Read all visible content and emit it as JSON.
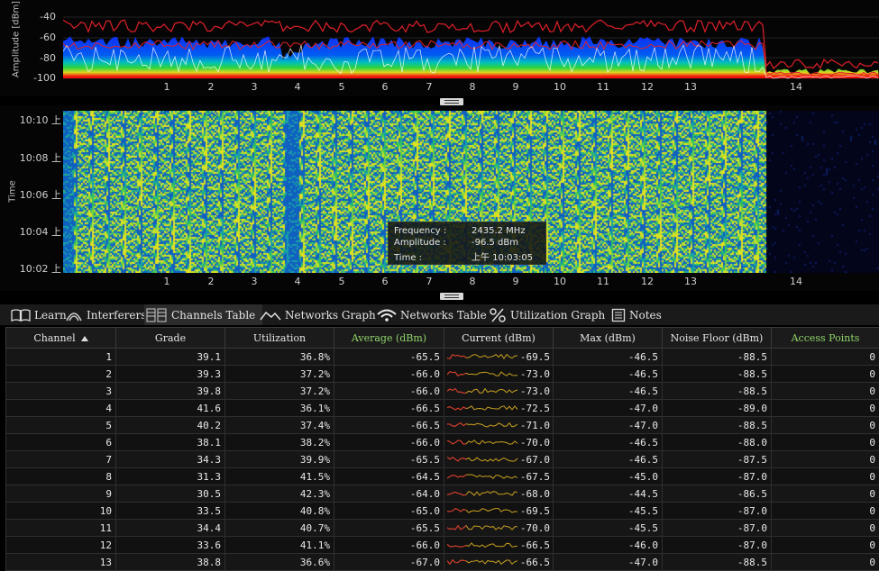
{
  "spectrum": {
    "ylabel": "Amplitude [dBm]",
    "yticks": [
      "-40",
      "-60",
      "-80",
      "-100"
    ],
    "xticks": [
      "1",
      "2",
      "3",
      "4",
      "5",
      "6",
      "7",
      "8",
      "9",
      "10",
      "11",
      "12",
      "13",
      "14"
    ]
  },
  "waterfall": {
    "ylabel": "Time",
    "yticks": [
      "10:10 上",
      "10:08 上",
      "10:06 上",
      "10:04 上",
      "10:02 上"
    ],
    "xticks": [
      "1",
      "2",
      "3",
      "4",
      "5",
      "6",
      "7",
      "8",
      "9",
      "10",
      "11",
      "12",
      "13",
      "14"
    ]
  },
  "tooltip": {
    "freq_label": "Frequency :",
    "freq_value": "2435.2 MHz",
    "amp_label": "Amplitude :",
    "amp_value": "-96.5 dBm",
    "time_label": "Time :",
    "time_value": "上午 10:03:05"
  },
  "tabs": [
    {
      "label": "Learn",
      "icon": "book-icon"
    },
    {
      "label": "Interferers",
      "icon": "interferer-icon"
    },
    {
      "label": "Channels Table",
      "icon": "table-icon",
      "active": true
    },
    {
      "label": "Networks Graph",
      "icon": "graph-icon"
    },
    {
      "label": "Networks Table",
      "icon": "wifi-icon"
    },
    {
      "label": "Utilization Graph",
      "icon": "percent-icon"
    },
    {
      "label": "Notes",
      "icon": "notes-icon"
    }
  ],
  "table": {
    "columns": [
      "Channel",
      "Grade",
      "Utilization",
      "Average (dBm)",
      "Current (dBm)",
      "Max (dBm)",
      "Noise Floor (dBm)",
      "Access Points"
    ],
    "rows": [
      [
        "1",
        "39.1",
        "36.8%",
        "-65.5",
        "-69.5",
        "-46.5",
        "-88.5",
        "0"
      ],
      [
        "2",
        "39.3",
        "37.2%",
        "-66.0",
        "-73.0",
        "-46.5",
        "-88.5",
        "0"
      ],
      [
        "3",
        "39.8",
        "37.2%",
        "-66.0",
        "-73.0",
        "-46.5",
        "-88.5",
        "0"
      ],
      [
        "4",
        "41.6",
        "36.1%",
        "-66.5",
        "-72.5",
        "-47.0",
        "-89.0",
        "0"
      ],
      [
        "5",
        "40.2",
        "37.4%",
        "-66.5",
        "-71.0",
        "-47.0",
        "-88.5",
        "0"
      ],
      [
        "6",
        "38.1",
        "38.2%",
        "-66.0",
        "-70.0",
        "-46.5",
        "-88.0",
        "0"
      ],
      [
        "7",
        "34.3",
        "39.9%",
        "-65.5",
        "-67.0",
        "-46.5",
        "-87.5",
        "0"
      ],
      [
        "8",
        "31.3",
        "41.5%",
        "-64.5",
        "-67.5",
        "-45.0",
        "-87.0",
        "0"
      ],
      [
        "9",
        "30.5",
        "42.3%",
        "-64.0",
        "-68.0",
        "-44.5",
        "-86.5",
        "0"
      ],
      [
        "10",
        "33.5",
        "40.8%",
        "-65.0",
        "-69.5",
        "-45.5",
        "-87.0",
        "0"
      ],
      [
        "11",
        "34.4",
        "40.7%",
        "-65.5",
        "-70.0",
        "-45.5",
        "-87.0",
        "0"
      ],
      [
        "12",
        "33.6",
        "41.1%",
        "-66.0",
        "-66.5",
        "-46.0",
        "-87.0",
        "0"
      ],
      [
        "13",
        "38.8",
        "36.6%",
        "-67.0",
        "-66.5",
        "-47.0",
        "-88.5",
        "0"
      ]
    ]
  },
  "colors": {
    "accent_green": "#8fd46a",
    "trace_red": "#e0202a",
    "trace_white": "#ffffff"
  }
}
